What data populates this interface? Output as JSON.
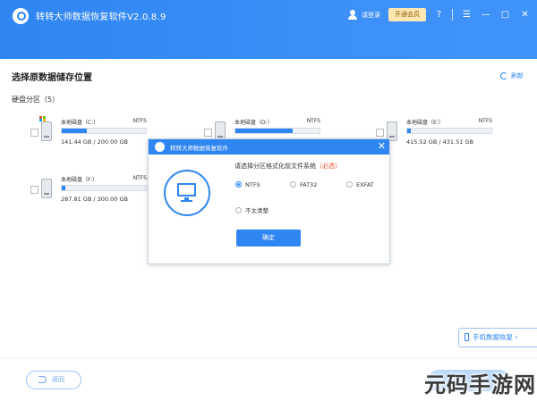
{
  "app": {
    "title": "转转大师数据恢复软件V2.0.8.9",
    "login": "请登录",
    "vip": "开通会员"
  },
  "colors": {
    "accent": "#2f86f2",
    "required": "#e4502b"
  },
  "icons": {
    "logo": "magnifier-logo-icon",
    "user": "user-icon",
    "help": "help-icon",
    "menu": "menu-icon",
    "minimize": "minimize-icon",
    "close": "close-icon",
    "refresh": "refresh-icon",
    "monitor": "monitor-icon",
    "back": "back-icon",
    "phone": "phone-icon"
  },
  "main": {
    "section_title": "选择原数据储存位置",
    "refresh": "刷新",
    "disk_section_label": "硬盘分区（5）"
  },
  "disks": [
    {
      "name": "本地磁盘（C:）",
      "fs": "NTFS",
      "size": "141.44 GB / 200.00 GB",
      "used_fraction": 0.3,
      "system": true
    },
    {
      "name": "本地磁盘（D:）",
      "fs": "NTFS",
      "size": "",
      "used_fraction": 0.68,
      "system": false
    },
    {
      "name": "本地磁盘（E:）",
      "fs": "NTFS",
      "size": "415.52 GB / 431.51 GB",
      "used_fraction": 0.04,
      "system": false
    },
    {
      "name": "本地磁盘（F:）",
      "fs": "NTFS",
      "size": "287.81 GB / 300.00 GB",
      "used_fraction": 0.04,
      "system": false
    }
  ],
  "dialog": {
    "title": "转转大师数据恢复软件",
    "prompt": "请选择分区格式化前文件系统",
    "required": "（必选）",
    "options": [
      {
        "label": "NTFS",
        "selected": true
      },
      {
        "label": "FAT32",
        "selected": false
      },
      {
        "label": "EXFAT",
        "selected": false
      },
      {
        "label": "不太清楚",
        "selected": false
      }
    ],
    "confirm": "确定"
  },
  "footer": {
    "back": "返回",
    "mobile_recover": "手机数据恢复 ›"
  },
  "watermark": "元码手游网"
}
